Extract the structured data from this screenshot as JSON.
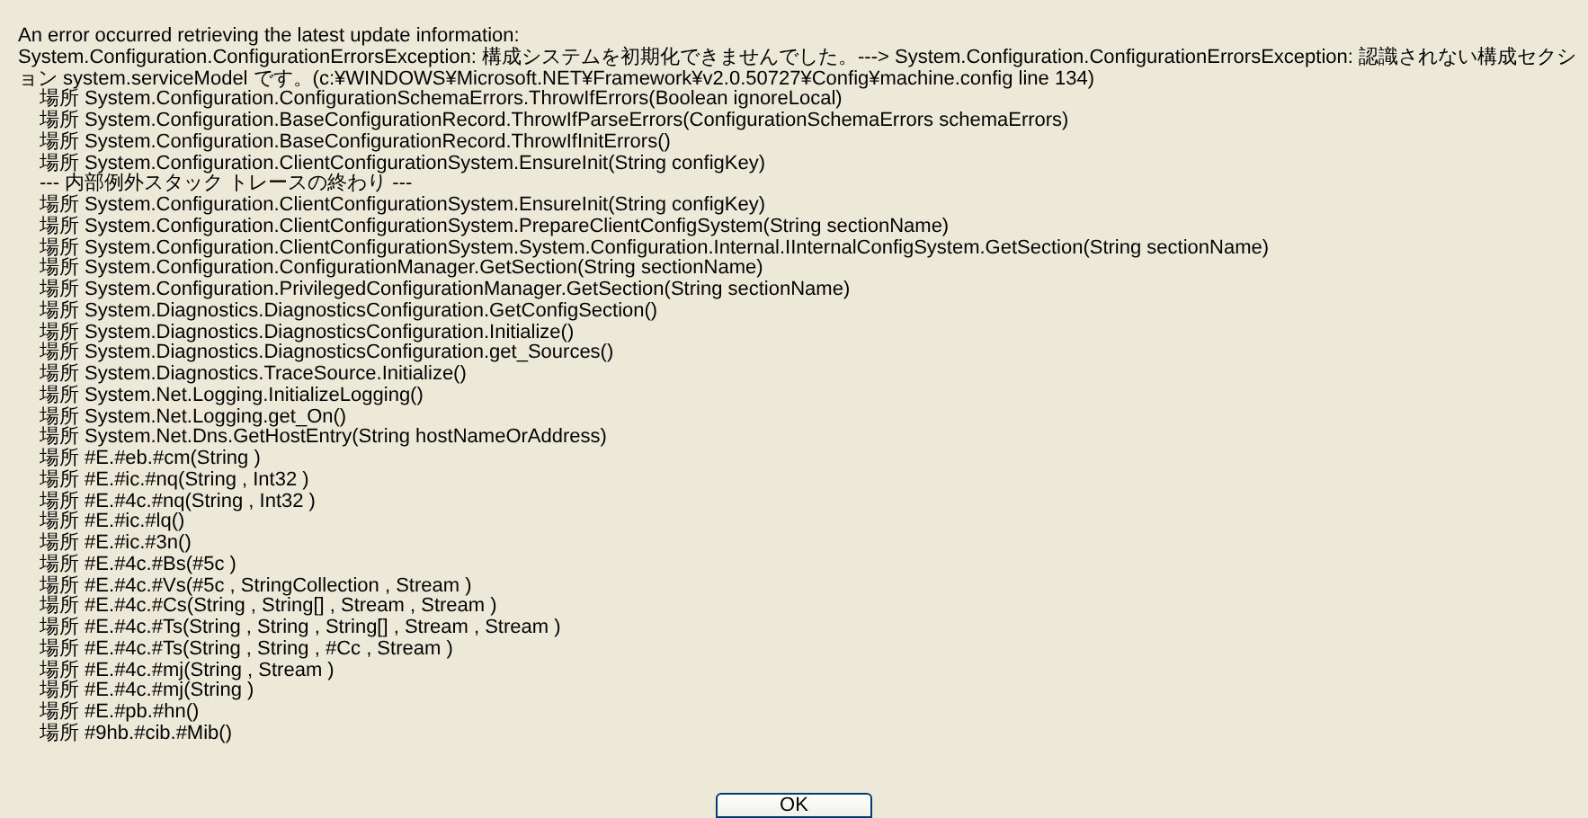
{
  "message": {
    "heading": "An error occurred retrieving the latest update information:",
    "detail": "System.Configuration.ConfigurationErrorsException: 構成システムを初期化できませんでした。---> System.Configuration.ConfigurationErrorsException: 認識されない構成セクション system.serviceModel です。(c:¥WINDOWS¥Microsoft.NET¥Framework¥v2.0.50727¥Config¥machine.config line 134)",
    "trace": [
      "場所 System.Configuration.ConfigurationSchemaErrors.ThrowIfErrors(Boolean ignoreLocal)",
      "場所 System.Configuration.BaseConfigurationRecord.ThrowIfParseErrors(ConfigurationSchemaErrors schemaErrors)",
      "場所 System.Configuration.BaseConfigurationRecord.ThrowIfInitErrors()",
      "場所 System.Configuration.ClientConfigurationSystem.EnsureInit(String configKey)",
      "--- 内部例外スタック トレースの終わり ---",
      "場所 System.Configuration.ClientConfigurationSystem.EnsureInit(String configKey)",
      "場所 System.Configuration.ClientConfigurationSystem.PrepareClientConfigSystem(String sectionName)",
      "場所 System.Configuration.ClientConfigurationSystem.System.Configuration.Internal.IInternalConfigSystem.GetSection(String sectionName)",
      "場所 System.Configuration.ConfigurationManager.GetSection(String sectionName)",
      "場所 System.Configuration.PrivilegedConfigurationManager.GetSection(String sectionName)",
      "場所 System.Diagnostics.DiagnosticsConfiguration.GetConfigSection()",
      "場所 System.Diagnostics.DiagnosticsConfiguration.Initialize()",
      "場所 System.Diagnostics.DiagnosticsConfiguration.get_Sources()",
      "場所 System.Diagnostics.TraceSource.Initialize()",
      "場所 System.Net.Logging.InitializeLogging()",
      "場所 System.Net.Logging.get_On()",
      "場所 System.Net.Dns.GetHostEntry(String hostNameOrAddress)",
      "場所 #E.#eb.#cm(String )",
      "場所 #E.#ic.#nq(String , Int32 )",
      "場所 #E.#4c.#nq(String , Int32 )",
      "場所 #E.#ic.#lq()",
      "場所 #E.#ic.#3n()",
      "場所 #E.#4c.#Bs(#5c )",
      "場所 #E.#4c.#Vs(#5c , StringCollection , Stream )",
      "場所 #E.#4c.#Cs(String , String[] , Stream , Stream )",
      "場所 #E.#4c.#Ts(String , String , String[] , Stream , Stream )",
      "場所 #E.#4c.#Ts(String , String , #Cc , Stream )",
      "場所 #E.#4c.#mj(String , Stream )",
      "場所 #E.#4c.#mj(String )",
      "場所 #E.#pb.#hn()",
      "場所 #9hb.#cib.#Mib()"
    ]
  },
  "buttons": [
    {
      "label": "OK"
    }
  ]
}
